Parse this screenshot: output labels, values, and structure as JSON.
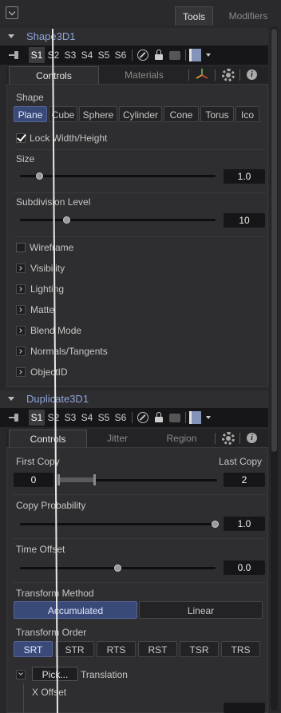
{
  "top_tabs": {
    "tools": "Tools",
    "modifiers": "Modifiers"
  },
  "tool1": {
    "name": "Shape3D1",
    "view_slots": [
      "S1",
      "S2",
      "S3",
      "S4",
      "S5",
      "S6"
    ],
    "tabs": {
      "controls": "Controls",
      "materials": "Materials"
    },
    "shape_label": "Shape",
    "shapes": [
      "Plane",
      "Cube",
      "Sphere",
      "Cylinder",
      "Cone",
      "Torus",
      "Ico"
    ],
    "selected_shape": "Plane",
    "lock_wh": {
      "label": "Lock Width/Height",
      "checked": true
    },
    "size": {
      "label": "Size",
      "value": "1.0",
      "fraction": 0.1
    },
    "subdivision": {
      "label": "Subdivision Level",
      "value": "10",
      "fraction": 0.24
    },
    "wireframe": {
      "label": "Wireframe",
      "checked": false
    },
    "sections": [
      "Visibility",
      "Lighting",
      "Matte",
      "Blend Mode",
      "Normals/Tangents",
      "ObjectID"
    ]
  },
  "tool2": {
    "name": "Duplicate3D1",
    "view_slots": [
      "S1",
      "S2",
      "S3",
      "S4",
      "S5",
      "S6"
    ],
    "tabs": {
      "controls": "Controls",
      "jitter": "Jitter",
      "region": "Region"
    },
    "first_copy": {
      "label": "First Copy",
      "value": "0"
    },
    "last_copy": {
      "label": "Last Copy",
      "value": "2"
    },
    "copy_probability": {
      "label": "Copy Probability",
      "value": "1.0",
      "fraction": 1.0
    },
    "time_offset": {
      "label": "Time Offset",
      "value": "0.0",
      "fraction": 0.5
    },
    "transform_method": {
      "label": "Transform Method",
      "options": [
        "Accumulated",
        "Linear"
      ],
      "selected": "Accumulated"
    },
    "transform_order": {
      "label": "Transform Order",
      "options": [
        "SRT",
        "STR",
        "RTS",
        "RST",
        "TSR",
        "TRS"
      ],
      "selected": "SRT"
    },
    "pick_label": "Pick...",
    "translation_label": "Translation",
    "x_offset_label": "X Offset"
  },
  "colors": {
    "accent": "#3a4a78",
    "tool_name": "#8fa3d8",
    "background": "#28282a"
  }
}
